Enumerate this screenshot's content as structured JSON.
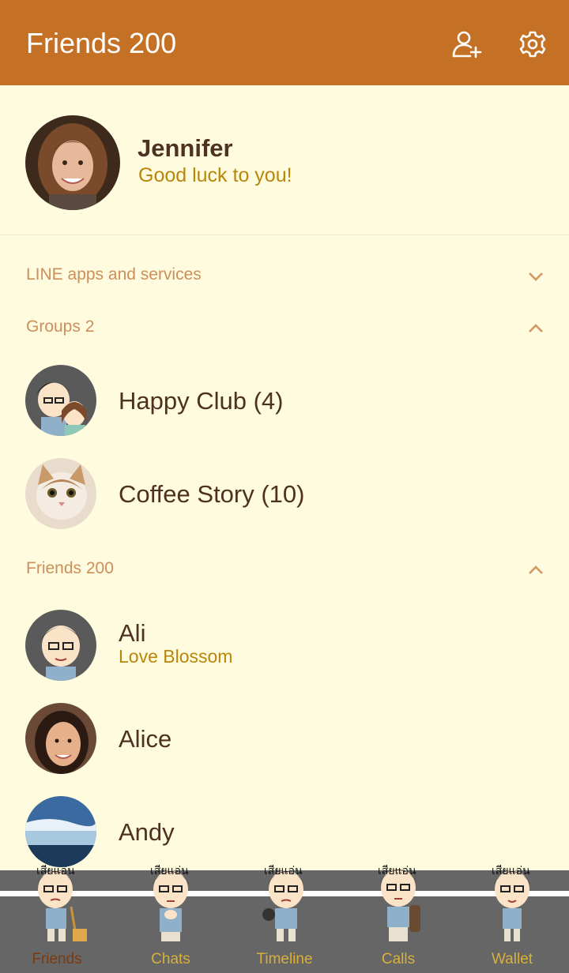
{
  "header": {
    "title": "Friends 200",
    "add_friend_icon": "add-person-icon",
    "settings_icon": "gear-icon"
  },
  "colors": {
    "header_bg": "#c47025",
    "page_bg": "#fffbdf",
    "name_text": "#4d3121",
    "status_text": "#b8860b",
    "section_label": "#cc8f5b",
    "tabbar_bg": "#666666",
    "tab_label": "#d8b03a",
    "tab_label_active": "#7a3a10"
  },
  "profile": {
    "name": "Jennifer",
    "status": "Good luck to you!"
  },
  "sections": {
    "apps": {
      "label": "LINE apps and services",
      "chevron": "chevron-down-icon"
    },
    "groups": {
      "label": "Groups 2",
      "chevron": "chevron-up-icon"
    },
    "friends": {
      "label": "Friends 200",
      "chevron": "chevron-up-icon"
    }
  },
  "groups": [
    {
      "name": "Happy Club (4)"
    },
    {
      "name": "Coffee Story (10)"
    }
  ],
  "friends": [
    {
      "name": "Ali",
      "status": "Love Blossom"
    },
    {
      "name": "Alice",
      "status": ""
    },
    {
      "name": "Andy",
      "status": ""
    }
  ],
  "tabs": [
    {
      "label": "Friends",
      "caption": "เสียแอ่น",
      "active": true
    },
    {
      "label": "Chats",
      "caption": "เสียแอ่น",
      "active": false
    },
    {
      "label": "Timeline",
      "caption": "เสียแอ่น",
      "active": false
    },
    {
      "label": "Calls",
      "caption": "เสียแอ่น",
      "active": false
    },
    {
      "label": "Wallet",
      "caption": "เสียแอ่น",
      "active": false
    }
  ]
}
